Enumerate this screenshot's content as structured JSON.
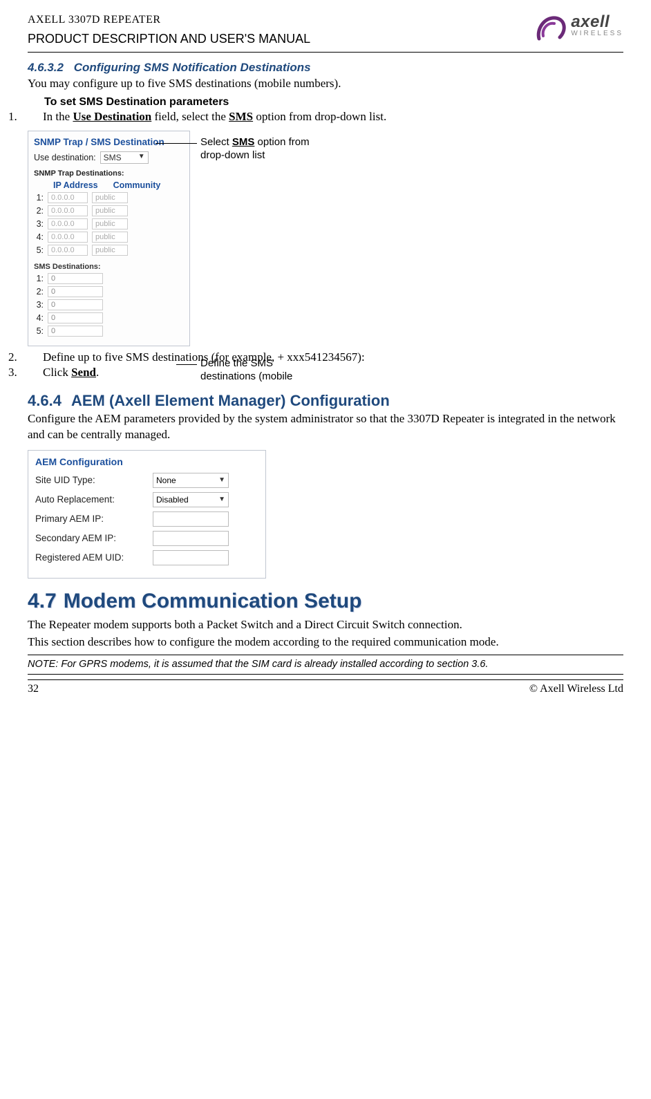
{
  "header": {
    "product_line": "AXELL 3307D REPEATER",
    "doc_title": "PRODUCT DESCRIPTION AND USER'S MANUAL",
    "logo_brand": "axell",
    "logo_sub": "WIRELESS"
  },
  "section_4_6_3_2": {
    "number": "4.6.3.2",
    "title": "Configuring SMS Notification Destinations",
    "intro": "You may configure up to five SMS destinations (mobile numbers).",
    "subhead": "To set SMS Destination parameters",
    "steps": {
      "s1_n": "1.",
      "s1_a": "In the ",
      "s1_b": "Use Destination",
      "s1_c": " field, select the ",
      "s1_d": "SMS",
      "s1_e": " option from drop-down list.",
      "s2_n": "2.",
      "s2": "Define up to five SMS destinations (for example, + xxx541234567):",
      "s3_n": "3.",
      "s3_a": "Click ",
      "s3_b": "Send",
      "s3_c": "."
    }
  },
  "panel1": {
    "group_title": "SNMP Trap / SMS Destination",
    "use_dest_label": "Use destination:",
    "use_dest_value": "SMS",
    "snmp_header": "SNMP Trap Destinations:",
    "col_ip": "IP Address",
    "col_comm": "Community",
    "rows": [
      {
        "n": "1:",
        "ip": "0.0.0.0",
        "comm": "public"
      },
      {
        "n": "2:",
        "ip": "0.0.0.0",
        "comm": "public"
      },
      {
        "n": "3:",
        "ip": "0.0.0.0",
        "comm": "public"
      },
      {
        "n": "4:",
        "ip": "0.0.0.0",
        "comm": "public"
      },
      {
        "n": "5:",
        "ip": "0.0.0.0",
        "comm": "public"
      }
    ],
    "sms_header": "SMS Destinations:",
    "sms_rows": [
      {
        "n": "1:",
        "v": "0"
      },
      {
        "n": "2:",
        "v": "0"
      },
      {
        "n": "3:",
        "v": "0"
      },
      {
        "n": "4:",
        "v": "0"
      },
      {
        "n": "5:",
        "v": "0"
      }
    ]
  },
  "annotations": {
    "a1_l1": "Select ",
    "a1_b": "SMS",
    "a1_l2": " option from",
    "a1_l3": "drop-down list",
    "a2_l1": "Define the SMS",
    "a2_l2": "destinations (mobile"
  },
  "section_4_6_4": {
    "number": "4.6.4",
    "title": "AEM (Axell Element Manager) Configuration",
    "body": "Configure the AEM parameters provided by the system administrator so that the 3307D Repeater is integrated in the network and can be centrally managed."
  },
  "aem_panel": {
    "title": "AEM Configuration",
    "rows": [
      {
        "label": "Site UID Type:",
        "value": "None",
        "dropdown": true
      },
      {
        "label": "Auto Replacement:",
        "value": "Disabled",
        "dropdown": true
      },
      {
        "label": "Primary AEM IP:",
        "value": "",
        "dropdown": false
      },
      {
        "label": "Secondary AEM IP:",
        "value": "",
        "dropdown": false
      },
      {
        "label": "Registered AEM UID:",
        "value": "",
        "dropdown": false
      }
    ]
  },
  "section_4_7": {
    "number": "4.7",
    "title": "Modem Communication Setup",
    "p1": "The Repeater modem supports both a Packet Switch and a Direct Circuit Switch connection.",
    "p2": "This section describes how to configure the modem according to the required communication mode.",
    "note": "NOTE: For GPRS modems, it is assumed that the SIM card is already installed according to section 3.6."
  },
  "footer": {
    "page": "32",
    "copyright": "© Axell Wireless Ltd"
  }
}
